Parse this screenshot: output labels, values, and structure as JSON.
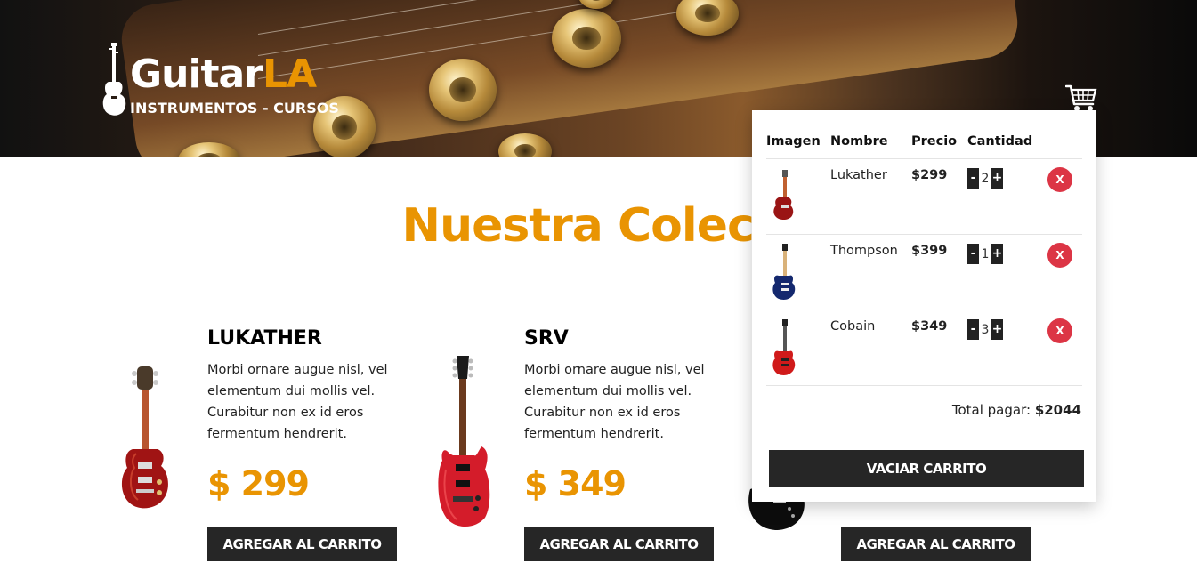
{
  "header": {
    "logo_main": "Guitar",
    "logo_accent": "LA",
    "logo_sub": "INSTRUMENTOS - CURSOS",
    "cart_icon": "cart-icon"
  },
  "colors": {
    "accent": "#e99402",
    "dark": "#262626",
    "danger": "#dc3545"
  },
  "main": {
    "title": "Nuestra Colecci"
  },
  "products": [
    {
      "name": "Lukather",
      "description": "Morbi ornare augue nisl, vel elementum dui mollis vel. Curabitur non ex id eros fermentum hendrerit.",
      "price": "$ 299",
      "button": "Agregar al carrito"
    },
    {
      "name": "SRV",
      "description": "Morbi ornare augue nisl, vel elementum dui mollis vel. Curabitur non ex id eros fermentum hendrerit.",
      "price": "$ 349",
      "button": "Agregar al carrito"
    },
    {
      "name": "",
      "description": "",
      "price": "",
      "button": "Agregar al carrito"
    }
  ],
  "cart": {
    "headers": [
      "Imagen",
      "Nombre",
      "Precio",
      "Cantidad"
    ],
    "items": [
      {
        "name": "Lukather",
        "price": "$299",
        "qty": "2",
        "minus": "-",
        "plus": "+",
        "remove": "X"
      },
      {
        "name": "Thompson",
        "price": "$399",
        "qty": "1",
        "minus": "-",
        "plus": "+",
        "remove": "X"
      },
      {
        "name": "Cobain",
        "price": "$349",
        "qty": "3",
        "minus": "-",
        "plus": "+",
        "remove": "X"
      }
    ],
    "total_label": "Total pagar: ",
    "total_value": "$2044",
    "clear_button": "Vaciar carrito"
  }
}
